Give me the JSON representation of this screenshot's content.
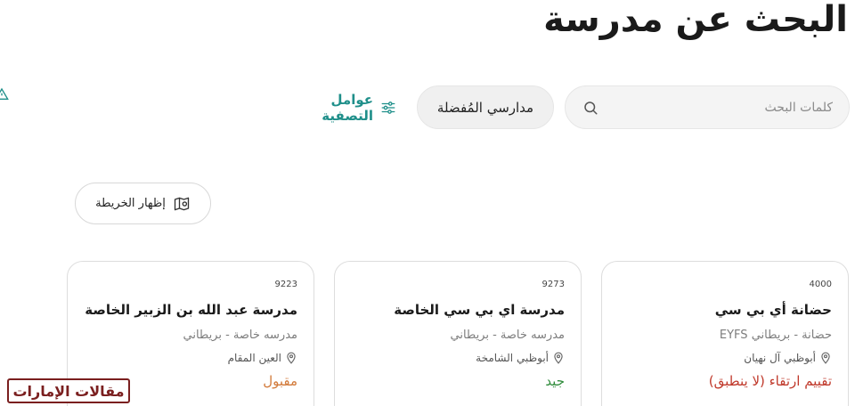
{
  "header": {
    "title": "البحث عن مدرسة"
  },
  "search": {
    "placeholder": "كلمات البحث",
    "icon": "search-icon"
  },
  "favorites": {
    "label": "مدارسي المُفضلة"
  },
  "filters": {
    "label": "عوامل التصفية",
    "icon": "sliders-icon"
  },
  "map_toggle": {
    "label": "إظهار الخريطة",
    "icon": "map-pin-icon"
  },
  "colors": {
    "accent": "#1f8f8a",
    "rating_red": "#c0392b",
    "rating_green": "#2e8b3a",
    "rating_orange": "#d27a3a"
  },
  "schools": [
    {
      "code": "4000",
      "name": "حضانة أي بي سي",
      "type": "حضانة - بريطاني EYFS",
      "location": "أبوظبي آل نهيان",
      "rating": "تقييم ارتقاء (لا ينطبق)",
      "rating_color": "#c0392b"
    },
    {
      "code": "9273",
      "name": "مدرسة اي بي سي الخاصة",
      "type": "مدرسه خاصة - بريطاني",
      "location": "أبوظبي الشامخة",
      "rating": "جيد",
      "rating_color": "#2e8b3a"
    },
    {
      "code": "9223",
      "name": "مدرسة عبد الله بن الزبير الخاصة",
      "type": "مدرسه خاصة - بريطاني",
      "location": "العين المقام",
      "rating": "مقبول",
      "rating_color": "#d27a3a"
    }
  ],
  "watermark": {
    "text": "مقالات الإمارات"
  }
}
